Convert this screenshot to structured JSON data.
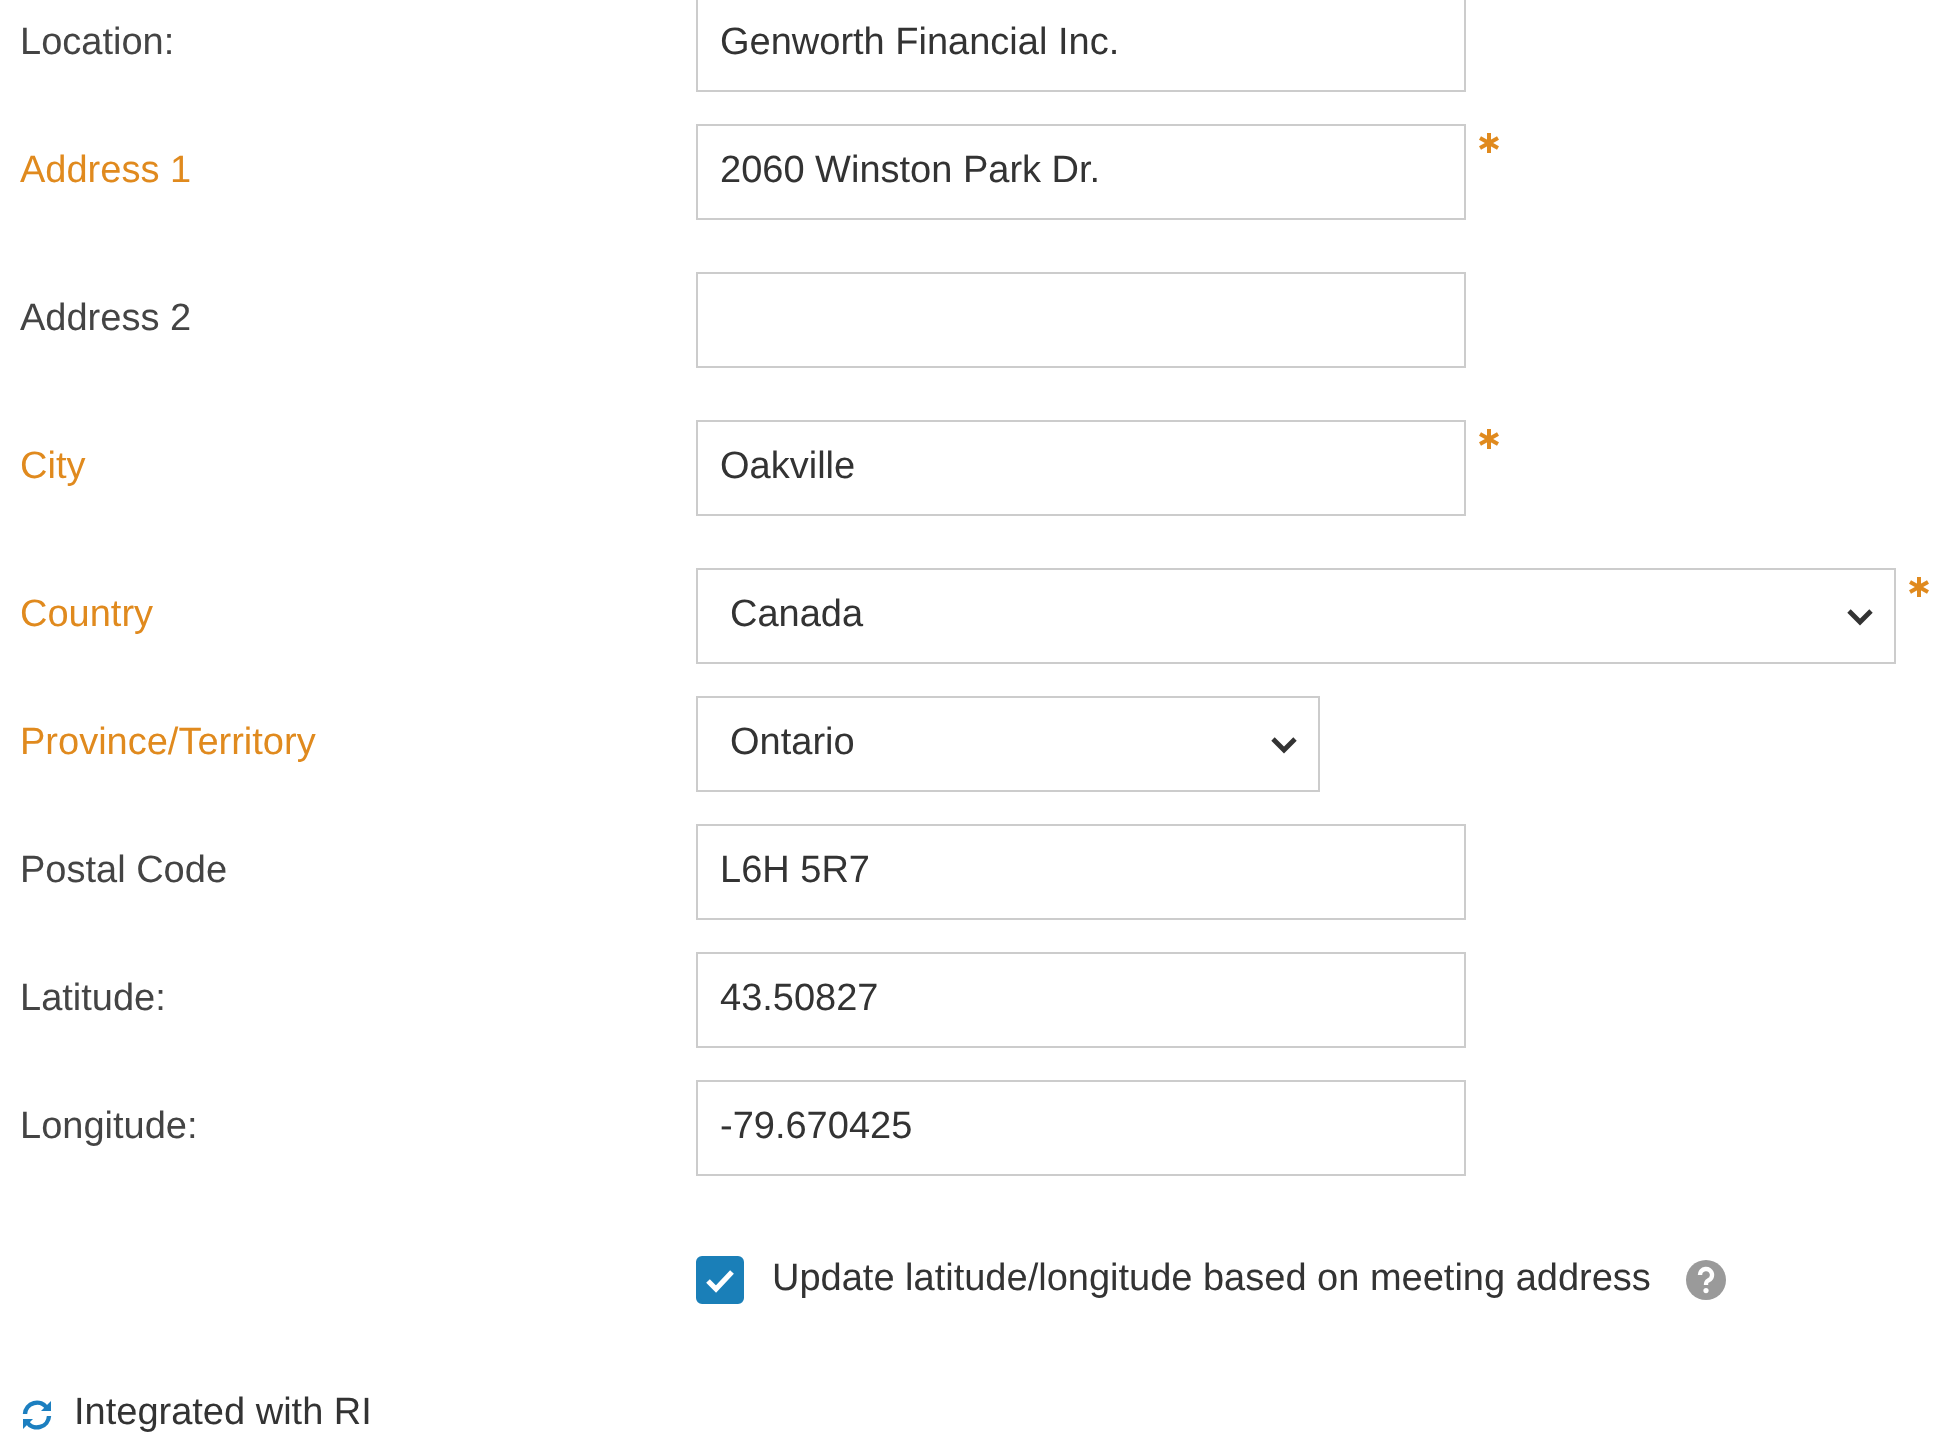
{
  "fields": [
    {
      "label": "Location:",
      "required": false,
      "asterisk": false,
      "kind": "text",
      "value": "Genworth Financial Inc."
    },
    {
      "label": "Address 1",
      "required": true,
      "asterisk": true,
      "kind": "text",
      "value": "2060 Winston Park Dr."
    },
    {
      "label": "Address 2",
      "required": false,
      "asterisk": false,
      "kind": "text"
    },
    {
      "label": "City",
      "required": true,
      "asterisk": true,
      "kind": "text",
      "value": "Oakville"
    },
    {
      "label": "Country",
      "required": true,
      "asterisk": true,
      "kind": "select-wide",
      "value": "Canada"
    },
    {
      "label": "Province/Territory",
      "required": true,
      "asterisk": false,
      "kind": "select",
      "value": "Ontario"
    },
    {
      "label": "Postal Code",
      "required": false,
      "asterisk": false,
      "kind": "text",
      "value": "L6H 5R7"
    },
    {
      "label": "Latitude:",
      "required": false,
      "asterisk": false,
      "kind": "text",
      "value": "43.50827"
    },
    {
      "label": "Longitude:",
      "required": false,
      "asterisk": false,
      "kind": "text",
      "value": "-79.670425"
    }
  ],
  "update_checkbox": {
    "label": "Update latitude/longitude based on meeting address",
    "checked": true
  },
  "integration_status": "Integrated with RI"
}
